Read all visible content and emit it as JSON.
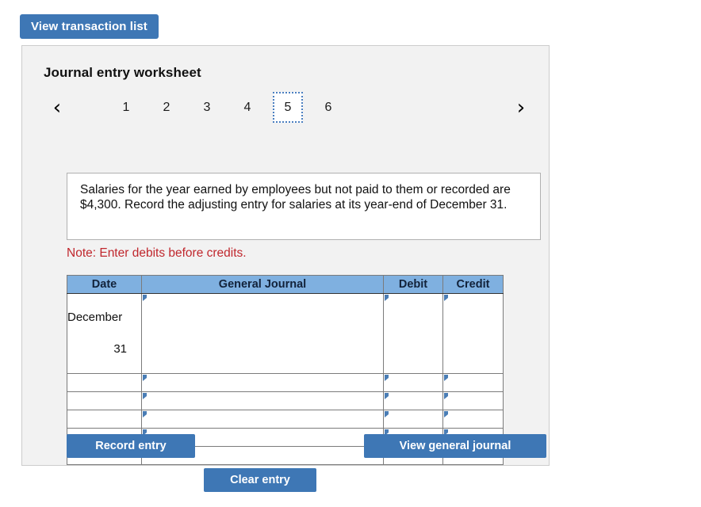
{
  "top_button": {
    "label": "View transaction list"
  },
  "panel": {
    "title": "Journal entry worksheet",
    "tabs": {
      "prev_icon": "chevron-left-icon",
      "next_icon": "chevron-right-icon",
      "items": [
        {
          "label": "1",
          "active": false
        },
        {
          "label": "2",
          "active": false
        },
        {
          "label": "3",
          "active": false
        },
        {
          "label": "4",
          "active": false
        },
        {
          "label": "5",
          "active": true
        },
        {
          "label": "6",
          "active": false
        }
      ],
      "active_tab": "5"
    },
    "description": "Salaries for the year earned by employees but not paid to them or recorded are $4,300. Record the adjusting entry for salaries at its year-end of December 31.",
    "note": "Note: Enter debits before credits.",
    "table": {
      "headers": [
        "Date",
        "General Journal",
        "Debit",
        "Credit"
      ],
      "rows": [
        {
          "date_line1": "December",
          "date_line2": "31",
          "general_journal": "",
          "debit": "",
          "credit": ""
        },
        {
          "date_line1": "",
          "date_line2": "",
          "general_journal": "",
          "debit": "",
          "credit": ""
        },
        {
          "date_line1": "",
          "date_line2": "",
          "general_journal": "",
          "debit": "",
          "credit": ""
        },
        {
          "date_line1": "",
          "date_line2": "",
          "general_journal": "",
          "debit": "",
          "credit": ""
        },
        {
          "date_line1": "",
          "date_line2": "",
          "general_journal": "",
          "debit": "",
          "credit": ""
        },
        {
          "date_line1": "",
          "date_line2": "",
          "general_journal": "",
          "debit": "",
          "credit": ""
        }
      ]
    },
    "buttons": {
      "record": "Record entry",
      "clear": "Clear entry",
      "view_general_journal": "View general journal"
    }
  },
  "colors": {
    "button_blue": "#3e77b5",
    "table_header_blue": "#7fb0e0",
    "note_red": "#c0272d",
    "panel_background": "#f2f2f2",
    "panel_border": "#cccccc",
    "marker_blue": "#4a7db5"
  }
}
